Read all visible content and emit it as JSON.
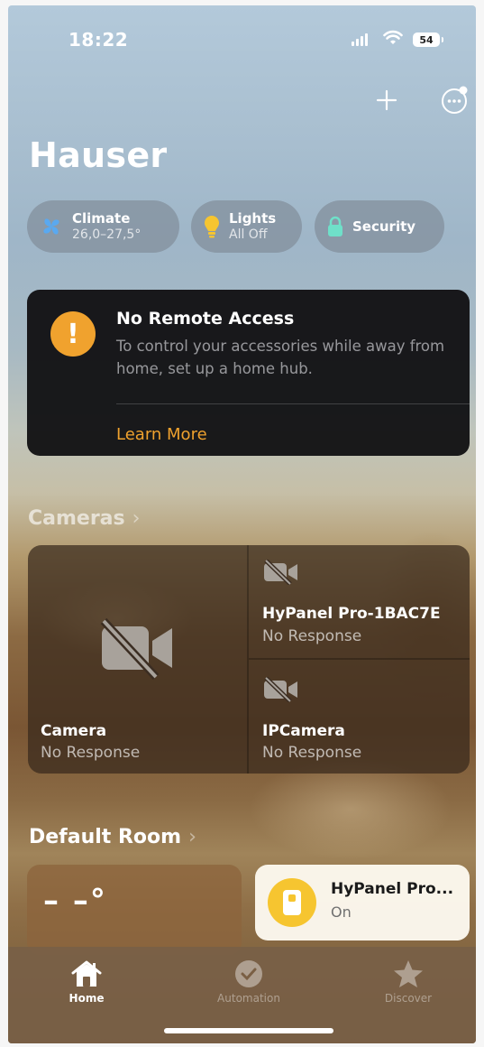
{
  "status_bar": {
    "time": "18:22",
    "battery": "54"
  },
  "header": {
    "title": "Hauser",
    "add_icon": "plus-icon",
    "more_icon": "ellipsis-circle-icon"
  },
  "chips": [
    {
      "label": "Climate",
      "sub": "26,0–27,5°",
      "icon": "fan-icon",
      "icon_color": "#5aa9f0"
    },
    {
      "label": "Lights",
      "sub": "All Off",
      "icon": "lightbulb-icon",
      "icon_color": "#f6c530"
    },
    {
      "label": "Security",
      "icon": "lock-icon",
      "icon_color": "#6fe0c9"
    }
  ],
  "alert": {
    "title": "No Remote Access",
    "body": "To control your accessories while away from home, set up a home hub.",
    "link": "Learn More",
    "icon": "exclamation-icon",
    "accent": "#f0a22e"
  },
  "cameras": {
    "heading": "Cameras",
    "items": [
      {
        "name": "Camera",
        "status": "No Response"
      },
      {
        "name": "HyPanel Pro-1BAC7E",
        "status": "No Response"
      },
      {
        "name": "IPCamera",
        "status": "No Response"
      }
    ]
  },
  "room": {
    "heading": "Default Room",
    "temperature": "– –°",
    "accessory": {
      "name": "HyPanel Pro...",
      "state": "On",
      "icon_color": "#f6c530"
    }
  },
  "tabs": [
    {
      "label": "Home",
      "icon": "house-icon",
      "active": true
    },
    {
      "label": "Automation",
      "icon": "clock-check-icon",
      "active": false
    },
    {
      "label": "Discover",
      "icon": "star-icon",
      "active": false
    }
  ]
}
